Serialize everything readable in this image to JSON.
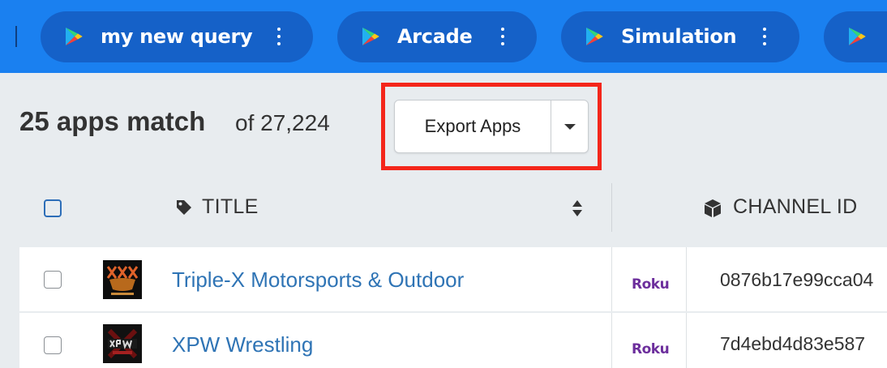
{
  "topbar": {
    "tabs": [
      {
        "label": "my new query",
        "icon": "google-play-icon"
      },
      {
        "label": "Arcade",
        "icon": "google-play-icon"
      },
      {
        "label": "Simulation",
        "icon": "google-play-icon"
      },
      {
        "label": "",
        "icon": "google-play-icon"
      }
    ],
    "color": "#1a80f0"
  },
  "results": {
    "count_label": "25 apps match",
    "total_label": "of 27,224"
  },
  "export": {
    "label": "Export Apps",
    "highlight_color": "#f4261b"
  },
  "table": {
    "columns": [
      {
        "label": "TITLE",
        "icon": "tag-icon"
      },
      {
        "label": "CHANNEL ID",
        "icon": "cube-icon"
      }
    ],
    "rows": [
      {
        "title": "Triple-X Motorsports & Outdoor",
        "platform": "Roku",
        "channel_id": "0876b17e99cca04"
      },
      {
        "title": "XPW Wrestling",
        "platform": "Roku",
        "channel_id": "7d4ebd4d83e587"
      }
    ]
  }
}
